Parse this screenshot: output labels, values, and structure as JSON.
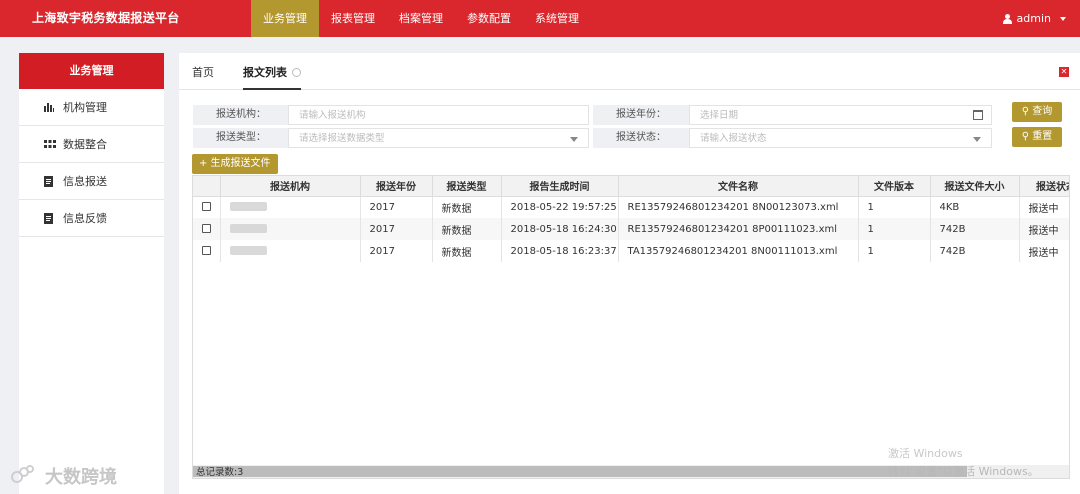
{
  "app": {
    "brand": "上海致宇税务数据报送平台",
    "user": "admin"
  },
  "nav": [
    {
      "label": "业务管理",
      "active": true
    },
    {
      "label": "报表管理",
      "active": false
    },
    {
      "label": "档案管理",
      "active": false
    },
    {
      "label": "参数配置",
      "active": false
    },
    {
      "label": "系统管理",
      "active": false
    }
  ],
  "sidebar": {
    "header": "业务管理",
    "items": [
      {
        "label": "机构管理",
        "icon": "bar-chart-icon"
      },
      {
        "label": "数据整合",
        "icon": "grid-icon"
      },
      {
        "label": "信息报送",
        "icon": "document-icon"
      },
      {
        "label": "信息反馈",
        "icon": "document-icon"
      }
    ]
  },
  "tabs": [
    {
      "label": "首页",
      "active": false
    },
    {
      "label": "报文列表",
      "active": true
    }
  ],
  "filters": {
    "org_label": "报送机构：",
    "org_placeholder": "请输入报送机构",
    "year_label": "报送年份：",
    "year_placeholder": "选择日期",
    "type_label": "报送类型：",
    "type_placeholder": "请选择报送数据类型",
    "status_label": "报送状态：",
    "status_placeholder": "请输入报送状态",
    "search_button": "查询",
    "reset_button": "重置"
  },
  "generate_button": "+ 生成报送文件",
  "table": {
    "columns": [
      "报送机构",
      "报送年份",
      "报送类型",
      "报告生成时间",
      "文件名称",
      "文件版本",
      "报送文件大小",
      "报送状态"
    ],
    "rows": [
      {
        "year": "2017",
        "type": "新数据",
        "time": "2018-05-22 19:57:25",
        "file": "RE13579246801234201 8N00123073.xml",
        "version": "1",
        "size": "4KB",
        "status": "报送中"
      },
      {
        "year": "2017",
        "type": "新数据",
        "time": "2018-05-18 16:24:30",
        "file": "RE13579246801234201 8P00111023.xml",
        "version": "1",
        "size": "742B",
        "status": "报送中"
      },
      {
        "year": "2017",
        "type": "新数据",
        "time": "2018-05-18 16:23:37",
        "file": "TA13579246801234201 8N00111013.xml",
        "version": "1",
        "size": "742B",
        "status": "报送中"
      }
    ],
    "total": "总记录数:3"
  },
  "watermark": {
    "line1": "激活 Windows",
    "line2": "转到\"设置\"以激活 Windows。",
    "logo": "大数跨境"
  },
  "colors": {
    "topbar": "#d9272d",
    "accent": "#b3972f",
    "sidebar_head": "#d21d24"
  }
}
